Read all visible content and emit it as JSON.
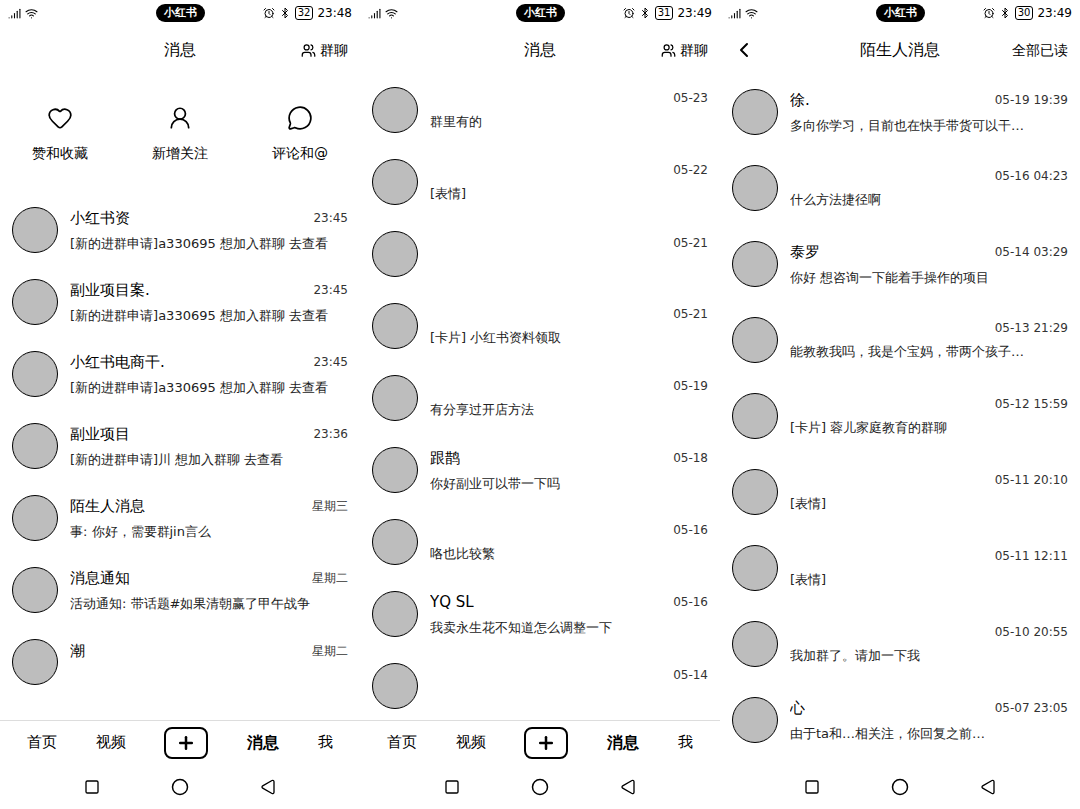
{
  "screens": [
    {
      "kind": "inbox",
      "status": {
        "app": "小红书",
        "battery": "32",
        "time": "23:48"
      },
      "header": {
        "title": "消息",
        "action": "群聊"
      },
      "shortcuts": [
        {
          "label": "赞和收藏",
          "icon": "heart"
        },
        {
          "label": "新增关注",
          "icon": "user"
        },
        {
          "label": "评论和@",
          "icon": "comment"
        }
      ],
      "conversations": [
        {
          "name": "小红书资",
          "time": "23:45",
          "preview": "[新的进群申请]a330695 想加入群聊 去查看"
        },
        {
          "name": "副业项目案.",
          "time": "23:45",
          "preview": "[新的进群申请]a330695 想加入群聊 去查看"
        },
        {
          "name": "小红书电商干.",
          "time": "23:45",
          "preview": "[新的进群申请]a330695 想加入群聊 去查看"
        },
        {
          "name": "副业项目",
          "time": "23:36",
          "preview": "[新的进群申请]川 想加入群聊 去查看"
        },
        {
          "name": "陌生人消息",
          "time": "星期三",
          "preview": "事: 你好，需要群jin言么"
        },
        {
          "name": "消息通知",
          "time": "星期二",
          "preview": "活动通知: 带话题#如果清朝赢了甲午战争"
        },
        {
          "name": "潮",
          "time": "星期二",
          "preview": ""
        }
      ],
      "tabbar": [
        {
          "label": "首页",
          "selected": false
        },
        {
          "label": "视频",
          "selected": false
        },
        {
          "label": "消息",
          "selected": true
        },
        {
          "label": "我",
          "selected": false
        }
      ]
    },
    {
      "kind": "inbox-scrolled",
      "status": {
        "app": "小红书",
        "battery": "31",
        "time": "23:49"
      },
      "header": {
        "title": "消息",
        "action": "群聊"
      },
      "conversations": [
        {
          "name": "",
          "time": "05-23",
          "preview": "群里有的"
        },
        {
          "name": "",
          "time": "05-22",
          "preview": "[表情]"
        },
        {
          "name": "",
          "time": "05-21",
          "preview": ""
        },
        {
          "name": "",
          "time": "05-21",
          "preview": "[卡片] 小红书资料领取"
        },
        {
          "name": "",
          "time": "05-19",
          "preview": "有分享过开店方法"
        },
        {
          "name": "跟鹊",
          "time": "05-18",
          "preview": "你好副业可以带一下吗"
        },
        {
          "name": "",
          "time": "05-16",
          "preview": "咯也比较繁"
        },
        {
          "name": "YQ SL",
          "time": "05-16",
          "preview": "我卖永生花不知道怎么调整一下"
        },
        {
          "name": "",
          "time": "05-14",
          "preview": ""
        }
      ],
      "tabbar": [
        {
          "label": "首页",
          "selected": false
        },
        {
          "label": "视频",
          "selected": false
        },
        {
          "label": "消息",
          "selected": true
        },
        {
          "label": "我",
          "selected": false
        }
      ]
    },
    {
      "kind": "strangers",
      "status": {
        "app": "小红书",
        "battery": "30",
        "time": "23:49"
      },
      "header": {
        "title": "陌生人消息",
        "action": "全部已读"
      },
      "conversations": [
        {
          "name": "徐.",
          "time": "05-19 19:39",
          "preview": "多向你学习，目前也在快手带货可以干…"
        },
        {
          "name": "",
          "time": "05-16 04:23",
          "preview": "什么方法捷径啊"
        },
        {
          "name": "泰罗",
          "time": "05-14 03:29",
          "preview": "你好 想咨询一下能着手操作的项目"
        },
        {
          "name": "",
          "time": "05-13 21:29",
          "preview": "能教教我吗，我是个宝妈，带两个孩子…"
        },
        {
          "name": "",
          "time": "05-12 15:59",
          "preview": "[卡片] 蓉儿家庭教育的群聊"
        },
        {
          "name": "",
          "time": "05-11 20:10",
          "preview": "[表情]"
        },
        {
          "name": "",
          "time": "05-11 12:11",
          "preview": "[表情]"
        },
        {
          "name": "",
          "time": "05-10 20:55",
          "preview": "我加群了。请加一下我"
        },
        {
          "name": "心",
          "time": "05-07 23:05",
          "preview": "由于ta和…相关注，你回复之前…"
        }
      ]
    }
  ]
}
